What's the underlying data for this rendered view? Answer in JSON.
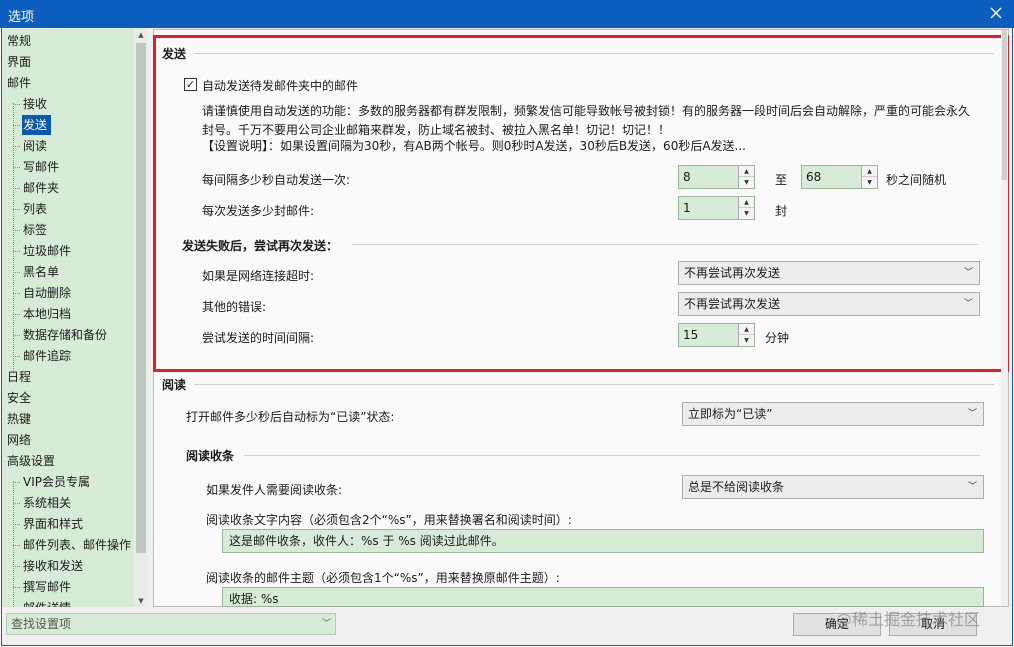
{
  "window": {
    "title": "选项"
  },
  "sidebar": {
    "items": [
      {
        "label": "常规",
        "level": 0
      },
      {
        "label": "界面",
        "level": 0
      },
      {
        "label": "邮件",
        "level": 0
      },
      {
        "label": "接收",
        "level": 1
      },
      {
        "label": "发送",
        "level": 1,
        "selected": true
      },
      {
        "label": "阅读",
        "level": 1
      },
      {
        "label": "写邮件",
        "level": 1
      },
      {
        "label": "邮件夹",
        "level": 1
      },
      {
        "label": "列表",
        "level": 1
      },
      {
        "label": "标签",
        "level": 1
      },
      {
        "label": "垃圾邮件",
        "level": 1
      },
      {
        "label": "黑名单",
        "level": 1
      },
      {
        "label": "自动删除",
        "level": 1
      },
      {
        "label": "本地归档",
        "level": 1
      },
      {
        "label": "数据存储和备份",
        "level": 1
      },
      {
        "label": "邮件追踪",
        "level": 1
      },
      {
        "label": "日程",
        "level": 0
      },
      {
        "label": "安全",
        "level": 0
      },
      {
        "label": "热键",
        "level": 0
      },
      {
        "label": "网络",
        "level": 0
      },
      {
        "label": "高级设置",
        "level": 0
      },
      {
        "label": "VIP会员专属",
        "level": 1
      },
      {
        "label": "系统相关",
        "level": 1
      },
      {
        "label": "界面和样式",
        "level": 1
      },
      {
        "label": "邮件列表、邮件操作",
        "level": 1
      },
      {
        "label": "接收和发送",
        "level": 1
      },
      {
        "label": "撰写邮件",
        "level": 1
      },
      {
        "label": "邮件详情",
        "level": 1
      }
    ]
  },
  "search": {
    "placeholder": "查找设置项"
  },
  "send": {
    "title": "发送",
    "auto_send_label": "自动发送待发邮件夹中的邮件",
    "auto_send_checked": true,
    "warning_line1": "请谨慎使用自动发送的功能：多数的服务器都有群发限制，频繁发信可能导致帐号被封锁！有的服务器一段时间后会自动解除，严重的可能会永久",
    "warning_line2": "封号。千万不要用公司企业邮箱来群发，防止域名被封、被拉入黑名单！切记！切记！！",
    "warning_line3": "【设置说明】：如果设置间隔为30秒，有AB两个帐号。则0秒时A发送，30秒后B发送，60秒后A发送...",
    "interval_label": "每间隔多少秒自动发送一次:",
    "interval_min": "8",
    "interval_to": "至",
    "interval_max": "68",
    "interval_suffix": "秒之间随机",
    "count_label": "每次发送多少封邮件:",
    "count_value": "1",
    "count_suffix": "封",
    "retry_title": "发送失败后，尝试再次发送：",
    "timeout_label": "如果是网络连接超时:",
    "timeout_value": "不再尝试再次发送",
    "other_label": "其他的错误:",
    "other_value": "不再尝试再次发送",
    "retry_interval_label": "尝试发送的时间间隔:",
    "retry_interval_value": "15",
    "retry_interval_suffix": "分钟"
  },
  "read": {
    "title": "阅读",
    "mark_read_label": "打开邮件多少秒后自动标为“已读”状态:",
    "mark_read_value": "立即标为“已读”",
    "receipt_title": "阅读收条",
    "receipt_request_label": "如果发件人需要阅读收条:",
    "receipt_request_value": "总是不给阅读收条",
    "receipt_text_label": "阅读收条文字内容（必须包含2个“%s”，用来替换署名和阅读时间）:",
    "receipt_text_value": "这是邮件收条，收件人：%s 于 %s 阅读过此邮件。",
    "receipt_subject_label": "阅读收条的邮件主题（必须包含1个“%s”，用来替换原邮件主题）:",
    "receipt_subject_value": "收据: %s"
  },
  "buttons": {
    "ok": "确定",
    "cancel": "取消"
  },
  "watermark": "@稀土掘金技术社区",
  "colors": {
    "accent": "#0a58b6",
    "highlight_border": "#e02025",
    "field_bg": "#d6ecd6"
  }
}
